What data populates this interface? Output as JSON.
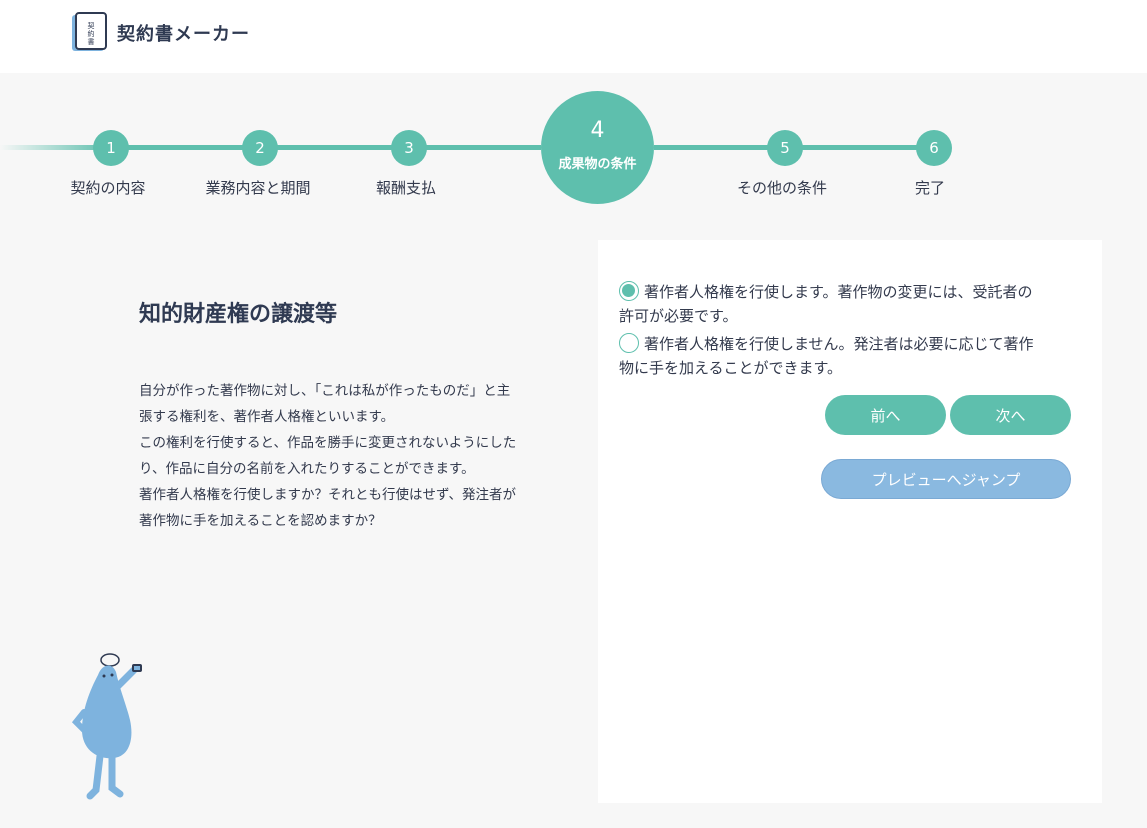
{
  "header": {
    "logo_icon": "contract-book-icon",
    "logo_icon_text": "契約書",
    "app_title": "契約書メーカー"
  },
  "stepper": {
    "active_index": 4,
    "steps": [
      {
        "number": "1",
        "label": "契約の内容"
      },
      {
        "number": "2",
        "label": "業務内容と期間"
      },
      {
        "number": "3",
        "label": "報酬支払"
      },
      {
        "number": "4",
        "label": "成果物の条件"
      },
      {
        "number": "5",
        "label": "その他の条件"
      },
      {
        "number": "6",
        "label": "完了"
      }
    ]
  },
  "main": {
    "title": "知的財産権の譲渡等",
    "description": [
      "自分が作った著作物に対し、「これは私が作ったものだ」と主",
      "張する権利を、著作者人格権といいます。",
      "この権利を行使すると、作品を勝手に変更されないようにした",
      "り、作品に自分の名前を入れたりすることができます。",
      "著作者人格権を行使しますか？それとも行使はせず、発注者が",
      "著作物に手を加えることを認めますか？"
    ]
  },
  "form": {
    "options": [
      {
        "label_line1": "著作者人格権を行使します。著作物の変更には、受託者の",
        "label_line2": "許可が必要です。",
        "selected": true
      },
      {
        "label_line1": "著作者人格権を行使しません。発注者は必要に応じて著作",
        "label_line2": "物に手を加えることができます。",
        "selected": false
      }
    ],
    "prev_label": "前へ",
    "next_label": "次へ",
    "preview_label": "プレビューへジャンプ"
  },
  "colors": {
    "accent": "#5ebfad",
    "preview_button": "#8ab9e0",
    "mascot": "#7eb3de",
    "text": "#333a4d"
  },
  "mascot_icon": "mascot-character-icon"
}
